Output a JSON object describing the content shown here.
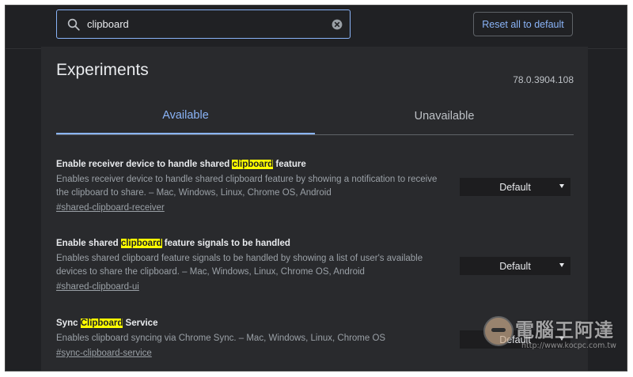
{
  "search": {
    "value": "clipboard",
    "placeholder": "Search flags"
  },
  "header": {
    "reset_label": "Reset all to default"
  },
  "page": {
    "title": "Experiments",
    "version": "78.0.3904.108"
  },
  "tabs": [
    {
      "label": "Available",
      "active": true
    },
    {
      "label": "Unavailable",
      "active": false
    }
  ],
  "experiments": [
    {
      "name_before": "Enable receiver device to handle shared ",
      "name_highlight": "clipboard",
      "name_after": " feature",
      "description": "Enables receiver device to handle shared clipboard feature by showing a notification to receive the clipboard to share. – Mac, Windows, Linux, Chrome OS, Android",
      "link": "#shared-clipboard-receiver",
      "value": "Default"
    },
    {
      "name_before": "Enable shared ",
      "name_highlight": "clipboard",
      "name_after": " feature signals to be handled",
      "description": "Enables shared clipboard feature signals to be handled by showing a list of user's available devices to share the clipboard. – Mac, Windows, Linux, Chrome OS, Android",
      "link": "#shared-clipboard-ui",
      "value": "Default"
    },
    {
      "name_before": "Sync ",
      "name_highlight": "Clipboard",
      "name_after": " Service",
      "description": "Enables clipboard syncing via Chrome Sync. – Mac, Windows, Linux, Chrome OS",
      "link": "#sync-clipboard-service",
      "value": "Default"
    }
  ],
  "watermark": {
    "text": "電腦王阿達",
    "url": "http://www.kocpc.com.tw"
  },
  "colors": {
    "background": "#202124",
    "panel": "#292a2d",
    "accent": "#8ab4f8",
    "highlight": "#ffff00"
  },
  "icons": {
    "search": "search-icon",
    "clear": "clear-icon",
    "dropdown": "dropdown-arrow-icon"
  }
}
